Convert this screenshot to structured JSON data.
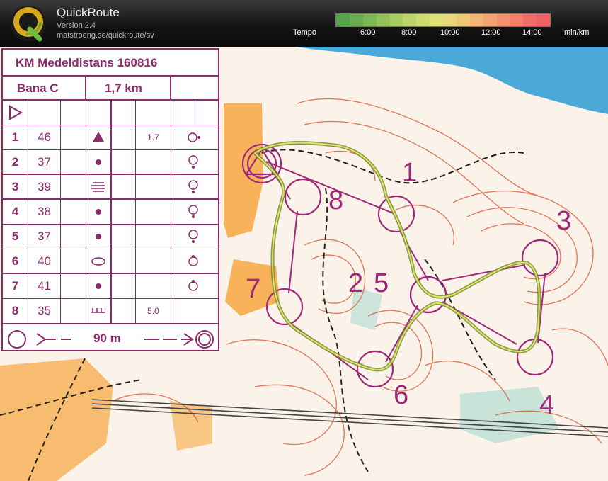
{
  "app": {
    "title": "QuickRoute",
    "version": "Version 2.4",
    "url": "matstroeng.se/quickroute/sv",
    "logo_letter": "Q"
  },
  "tempo": {
    "label": "Tempo",
    "ticks": [
      "6:00",
      "8:00",
      "10:00",
      "12:00",
      "14:00"
    ],
    "unit": "min/km"
  },
  "legend": {
    "title": "KM Medeldistans 160816",
    "course": "Bana C",
    "length": "1,7 km",
    "controls": [
      {
        "n": "1",
        "code": "46",
        "dim": "1.7"
      },
      {
        "n": "2",
        "code": "37",
        "dim": ""
      },
      {
        "n": "3",
        "code": "39",
        "dim": ""
      },
      {
        "n": "4",
        "code": "38",
        "dim": ""
      },
      {
        "n": "5",
        "code": "37",
        "dim": ""
      },
      {
        "n": "6",
        "code": "40",
        "dim": ""
      },
      {
        "n": "7",
        "code": "41",
        "dim": ""
      },
      {
        "n": "8",
        "code": "35",
        "dim": "5.0"
      }
    ],
    "finish_distance": "90 m"
  },
  "map_labels": [
    "1",
    "2",
    "3",
    "4",
    "5",
    "6",
    "7",
    "8"
  ],
  "colors": {
    "course": "#a0287a",
    "route": "#8fbf4a",
    "water": "#4aa9d6",
    "open_land": "#f7b25a"
  }
}
